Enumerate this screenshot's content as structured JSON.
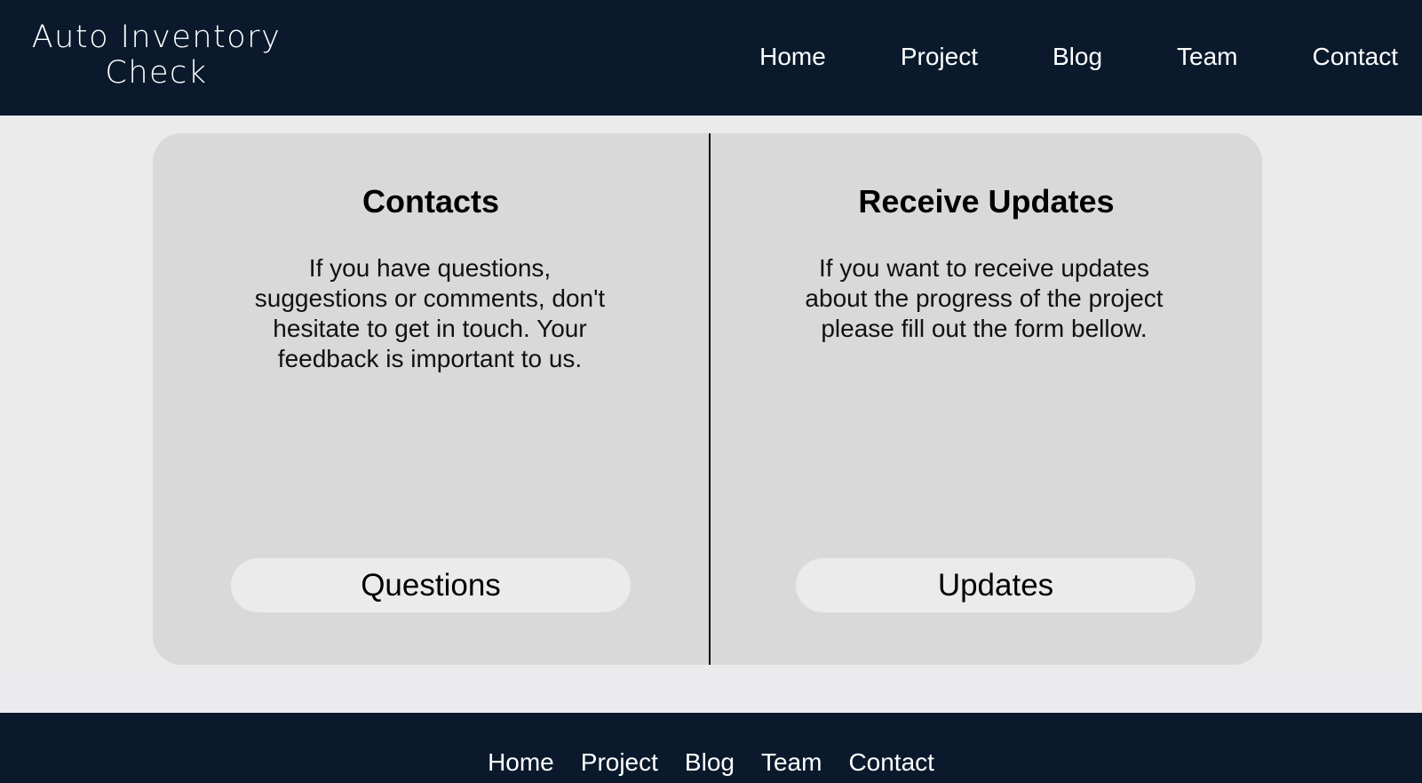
{
  "header": {
    "logo_line1": "Auto Inventory",
    "logo_line2": "Check",
    "nav": [
      "Home",
      "Project",
      "Blog",
      "Team",
      "Contact"
    ]
  },
  "contacts": {
    "title": "Contacts",
    "text": "If you have questions, suggestions or comments, don't hesitate to get in touch. Your feedback is important to us.",
    "button": "Questions"
  },
  "updates": {
    "title": "Receive Updates",
    "text": "If you want to receive updates about the progress of the project please fill out the form bellow.",
    "button": "Updates"
  },
  "footer": {
    "nav": [
      "Home",
      "Project",
      "Blog",
      "Team",
      "Contact"
    ]
  },
  "colors": {
    "header_bg": "#0a1a2c",
    "page_bg": "#ebebeb",
    "panel_bg": "#d9d9d9",
    "button_bg": "#ebebeb"
  }
}
